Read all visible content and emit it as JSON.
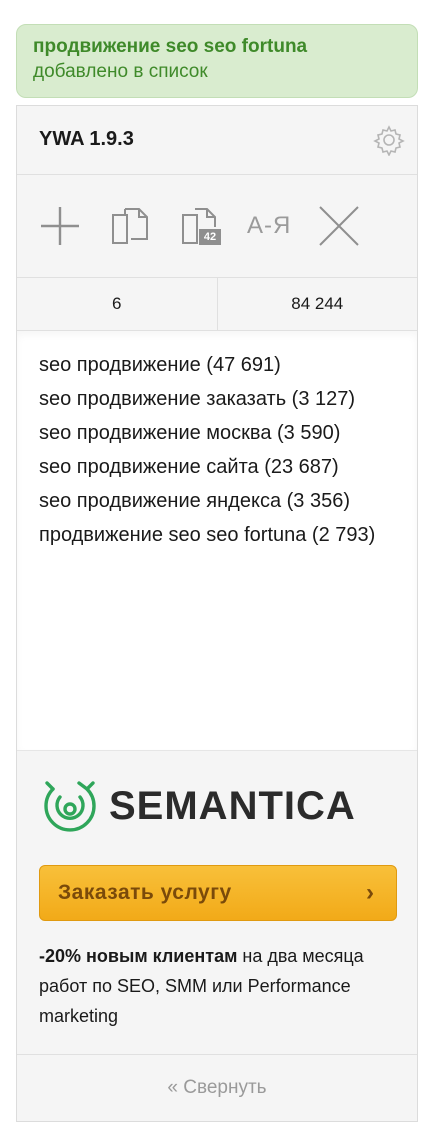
{
  "notification": {
    "keyword": "продвижение seo seo fortuna",
    "message": "добавлено в список"
  },
  "header": {
    "title": "YWA 1.9.3",
    "settings_icon": "gear-icon"
  },
  "toolbar": {
    "add_icon": "plus-icon",
    "copy_icon": "copy-icon",
    "copy_freq_icon": "copy-with-frequency-icon",
    "copy_freq_badge": "42",
    "sort_label": "А-Я",
    "clear_icon": "close-icon"
  },
  "stats": {
    "count": "6",
    "total_frequency": "84 244"
  },
  "keywords": [
    "seo продвижение (47 691)",
    "seo продвижение заказать (3 127)",
    "seo продвижение москва (3 590)",
    "seo продвижение сайта (23 687)",
    "seo продвижение яндекса (3 356)",
    "продвижение seo seo fortuna (2 793)"
  ],
  "promo": {
    "brand": "SEMANTICA",
    "button_label": "Заказать услугу",
    "offer_bold": "-20% новым клиентам",
    "offer_rest": " на два месяца работ по SEO, SMM или Performance marketing"
  },
  "footer": {
    "collapse_label": "« Свернуть"
  },
  "colors": {
    "notification_bg": "#d9eccf",
    "notification_text": "#3f8a2a",
    "button_bg": "#f5b528",
    "brand_green": "#2fa65a"
  }
}
